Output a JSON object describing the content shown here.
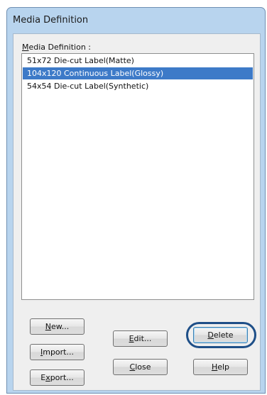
{
  "window": {
    "title": "Media Definition"
  },
  "list": {
    "label_mnemonic": "M",
    "label_rest": "edia Definition :",
    "items": [
      {
        "label": "51x72 Die-cut Label(Matte)",
        "selected": false
      },
      {
        "label": "104x120 Continuous Label(Glossy)",
        "selected": true
      },
      {
        "label": "54x54 Die-cut Label(Synthetic)",
        "selected": false
      }
    ]
  },
  "buttons": {
    "new": {
      "mnemonic": "N",
      "rest": "ew..."
    },
    "import": {
      "mnemonic": "I",
      "rest": "mport..."
    },
    "export": {
      "pre": "E",
      "mnemonic": "x",
      "rest": "port..."
    },
    "edit": {
      "mnemonic": "E",
      "rest": "dit..."
    },
    "close": {
      "mnemonic": "C",
      "rest": "lose"
    },
    "delete": {
      "mnemonic": "D",
      "rest": "elete"
    },
    "help": {
      "mnemonic": "H",
      "rest": "elp"
    }
  },
  "colors": {
    "selection": "#3d7ac8",
    "highlight_ring": "#1e4f88",
    "frame": "#b8d4ee"
  }
}
